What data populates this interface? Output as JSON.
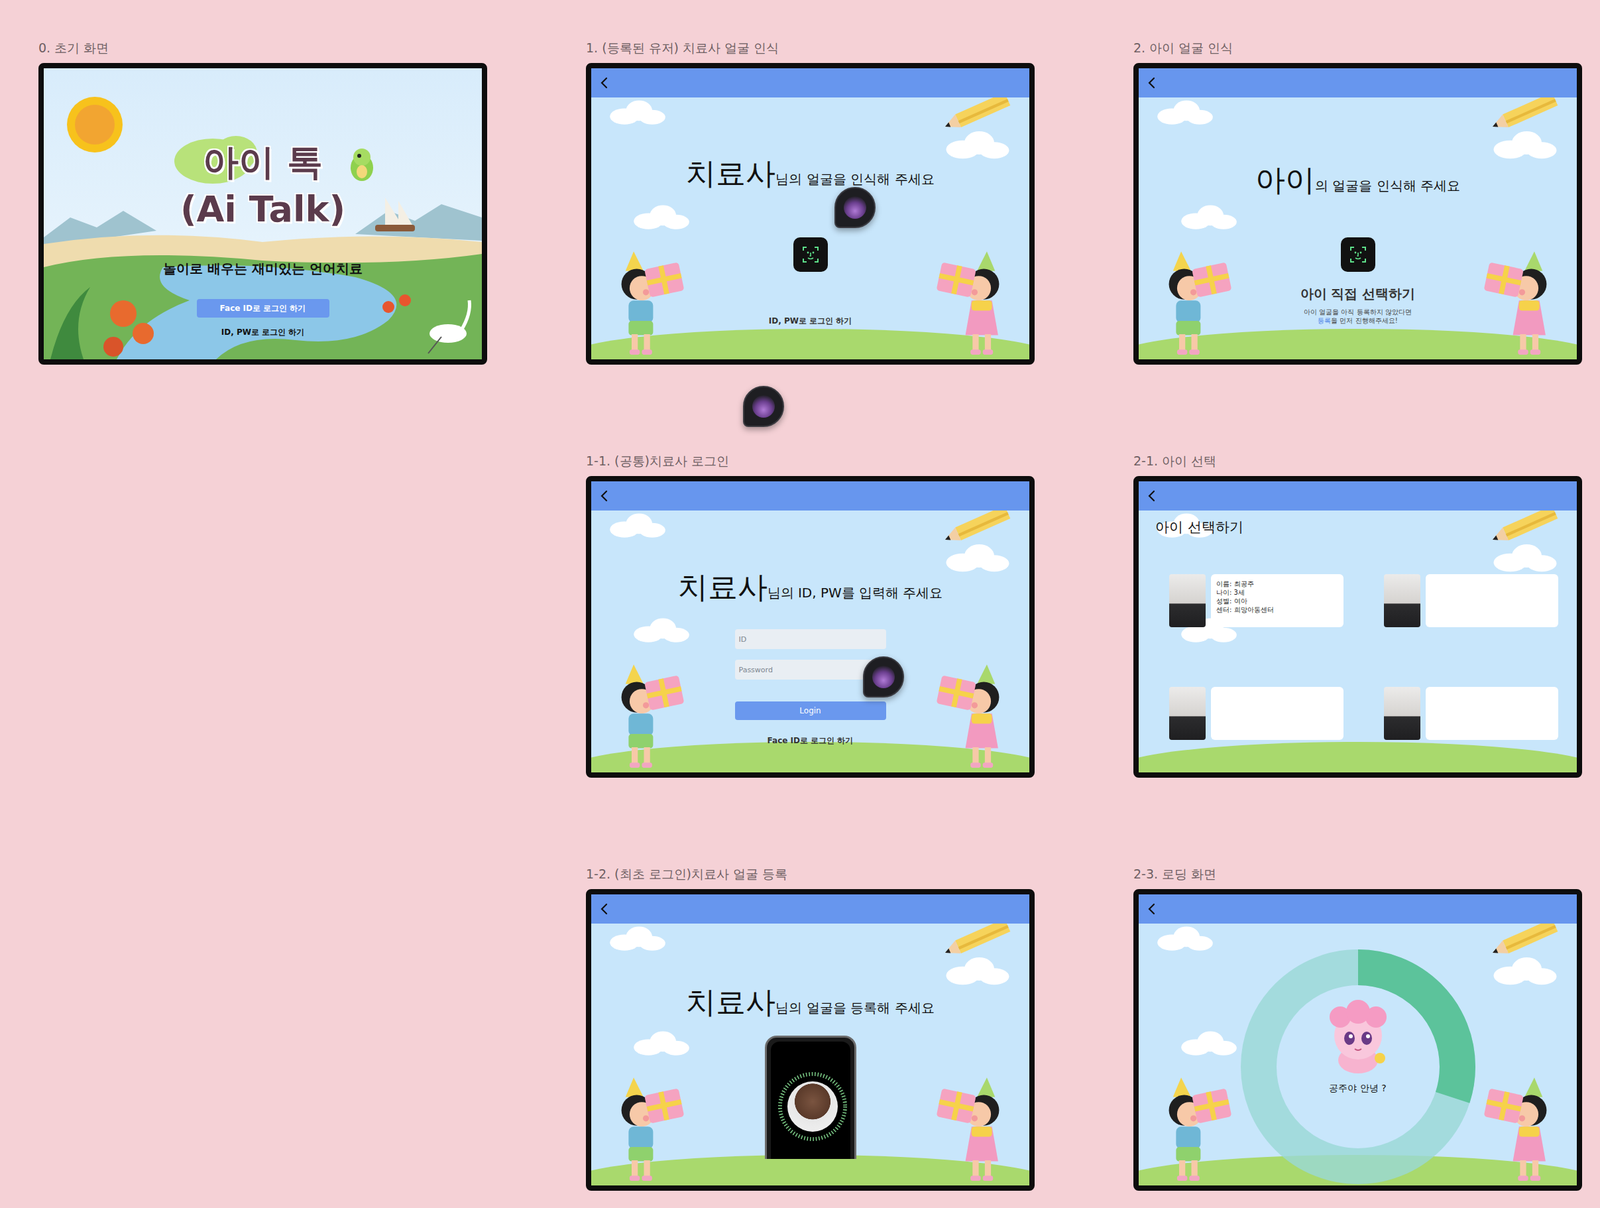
{
  "canvas": {
    "frames": [
      {
        "label": "0. 초기 화면",
        "kind": "splash",
        "title": "아이 톡",
        "subtitle": "(Ai Talk)",
        "tagline": "놀이로 배우는 재미있는 언어치료",
        "button": "Face ID로 로그인 하기",
        "link": "ID, PW로 로그인 하기"
      },
      {
        "label": "1. (등록된 유저) 치료사 얼굴 인식",
        "kind": "face-scan",
        "heading_strong": "치료사",
        "heading_rest": "님의 얼굴을 인식해 주세요",
        "link": "ID, PW로 로그인 하기"
      },
      {
        "label": "2. 아이 얼굴 인식",
        "kind": "child-scan",
        "heading_strong": "아이",
        "heading_rest": "의 얼굴을 인식해 주세요",
        "choose": "아이 직접 선택하기",
        "note_line": "아이 얼굴을 아직 등록하지 않았다면",
        "note_link": "등록",
        "note_rest": "을 먼저 진행해주세요!"
      },
      {
        "label": "1-1. (공통)치료사 로그인",
        "kind": "login",
        "heading_strong": "치료사",
        "heading_rest": "님의 ID, PW를 입력해 주세요",
        "fields": [
          {
            "placeholder": "ID"
          },
          {
            "placeholder": "Password"
          }
        ],
        "button": "Login",
        "link": "Face ID로 로그인 하기"
      },
      {
        "label": "2-1. 아이 선택",
        "kind": "child-select",
        "title": "아이 선택하기",
        "children": [
          {
            "info": [
              "이름: 최공주",
              "나이: 3세",
              "성별: 여아",
              "센터: 희망아동센터"
            ]
          },
          {
            "info": []
          },
          {
            "info": []
          },
          {
            "info": []
          }
        ]
      },
      {
        "label": "1-2. (최초 로그인)치료사 얼굴 등록",
        "kind": "face-register",
        "heading_strong": "치료사",
        "heading_rest": "님의 얼굴을 등록해 주세요"
      },
      {
        "label": "2-3. 로딩 화면",
        "kind": "loading",
        "level": 0.3,
        "greeting": "공주야 안녕 ?"
      }
    ]
  }
}
